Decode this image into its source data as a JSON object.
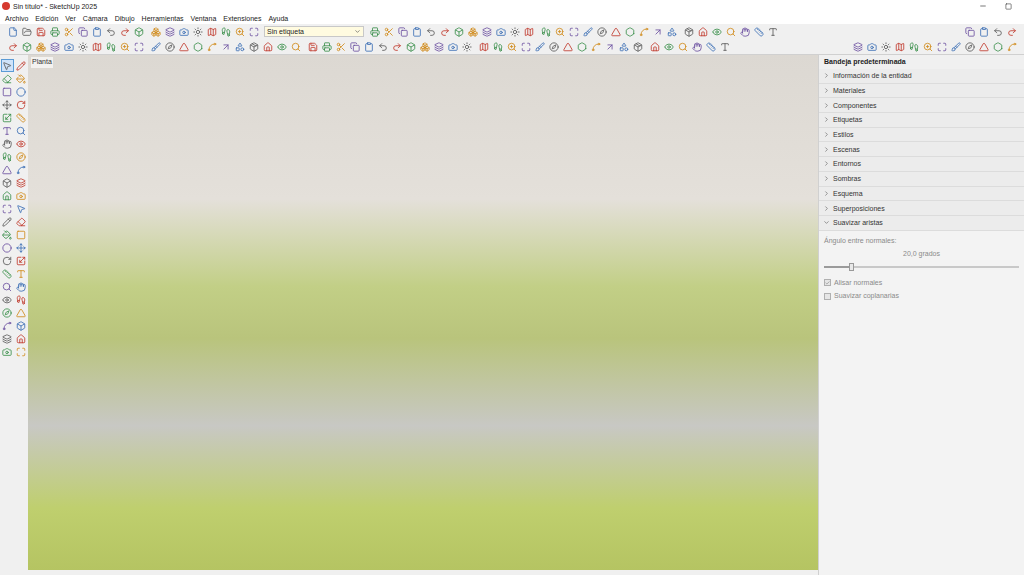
{
  "window": {
    "title": "Sin título* - SketchUp 2025"
  },
  "menu": [
    "Archivo",
    "Edición",
    "Ver",
    "Cámara",
    "Dibujo",
    "Herramientas",
    "Ventana",
    "Extensiones",
    "Ayuda"
  ],
  "toolbar": {
    "tag_dropdown": "Sin etiqueta"
  },
  "left_toolbar": {
    "active_tool_index": 0
  },
  "viewport": {
    "scene_label": "Planta"
  },
  "tray": {
    "title": "Bandeja predeterminada",
    "panels": [
      {
        "label": "Información de la entidad",
        "expanded": false
      },
      {
        "label": "Materiales",
        "expanded": false
      },
      {
        "label": "Componentes",
        "expanded": false
      },
      {
        "label": "Etiquetas",
        "expanded": false
      },
      {
        "label": "Estilos",
        "expanded": false
      },
      {
        "label": "Escenas",
        "expanded": false
      },
      {
        "label": "Entornos",
        "expanded": false
      },
      {
        "label": "Sombras",
        "expanded": false
      },
      {
        "label": "Esquema",
        "expanded": false
      },
      {
        "label": "Superposiciones",
        "expanded": false
      },
      {
        "label": "Suavizar aristas",
        "expanded": true
      }
    ],
    "soften": {
      "angle_label": "Ángulo entre normales:",
      "angle_value": "20,0 grados",
      "level": 0.14,
      "options": [
        {
          "label": "Alisar normales",
          "checked": true,
          "disabled": true
        },
        {
          "label": "Suavizar coplanarias",
          "checked": false,
          "disabled": true
        }
      ]
    }
  }
}
